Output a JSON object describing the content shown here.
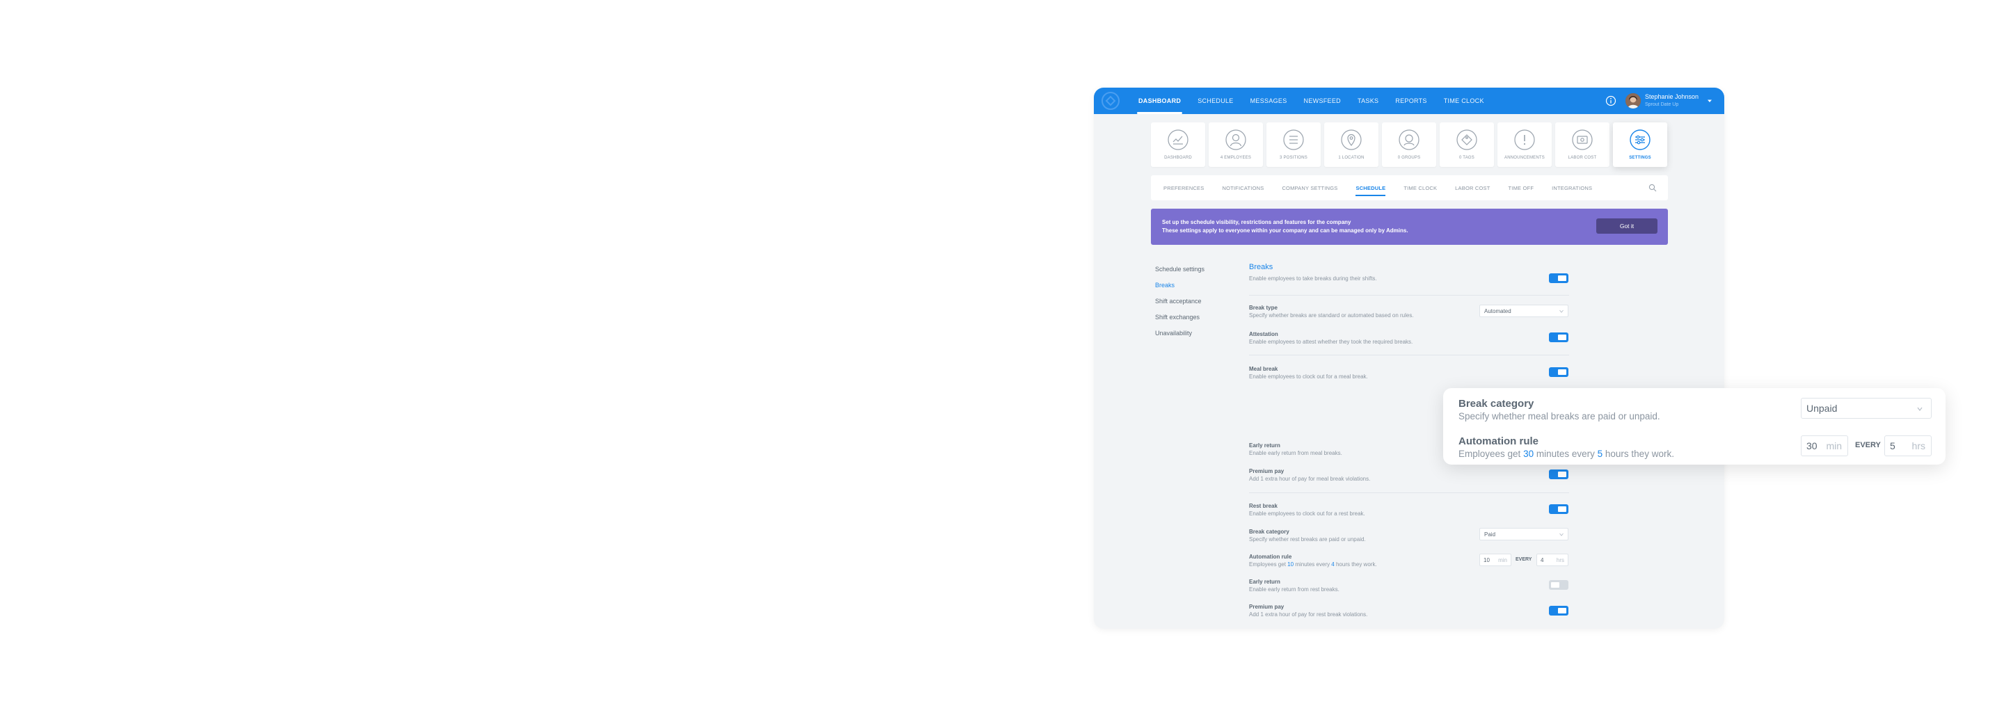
{
  "nav": {
    "items": [
      "DASHBOARD",
      "SCHEDULE",
      "MESSAGES",
      "NEWSFEED",
      "TASKS",
      "REPORTS",
      "TIME CLOCK"
    ],
    "user_name": "Stephanie Johnson",
    "user_company": "Sprout Date Up"
  },
  "tiles": [
    {
      "label": "DASHBOARD",
      "icon": "dashboard-icon"
    },
    {
      "label": "4 EMPLOYEES",
      "icon": "employees-icon"
    },
    {
      "label": "3 POSITIONS",
      "icon": "positions-icon"
    },
    {
      "label": "1 LOCATION",
      "icon": "location-icon"
    },
    {
      "label": "0 GROUPS",
      "icon": "groups-icon"
    },
    {
      "label": "0 TAGS",
      "icon": "tag-icon"
    },
    {
      "label": "ANNOUNCEMENTS",
      "icon": "alert-icon"
    },
    {
      "label": "LABOR COST",
      "icon": "labor-cost-icon"
    },
    {
      "label": "SETTINGS",
      "icon": "settings-icon"
    }
  ],
  "subtabs": [
    "PREFERENCES",
    "NOTIFICATIONS",
    "COMPANY SETTINGS",
    "SCHEDULE",
    "TIME CLOCK",
    "LABOR COST",
    "TIME OFF",
    "INTEGRATIONS"
  ],
  "banner": {
    "line1": "Set up the schedule visibility, restrictions and features for the company",
    "line2": "These settings apply to everyone within your company and can be managed only by Admins.",
    "button": "Got it"
  },
  "side_menu": [
    "Schedule settings",
    "Breaks",
    "Shift acceptance",
    "Shift exchanges",
    "Unavailability"
  ],
  "breaks": {
    "title": "Breaks",
    "desc": "Enable employees to take breaks during their shifts.",
    "break_type": {
      "title": "Break type",
      "desc": "Specify whether breaks are standard or automated based on rules.",
      "value": "Automated"
    },
    "attestation": {
      "title": "Attestation",
      "desc": "Enable employees to attest whether they took the required breaks."
    },
    "meal_break": {
      "title": "Meal break",
      "desc": "Enable employees to clock out for a meal break."
    },
    "meal_early_return": {
      "title": "Early return",
      "desc": "Enable early return from meal breaks."
    },
    "meal_premium_pay": {
      "title": "Premium pay",
      "desc": "Add 1 extra hour of pay for meal break violations."
    },
    "rest_break": {
      "title": "Rest break",
      "desc": "Enable employees to clock out for a rest break."
    },
    "rest_category": {
      "title": "Break category",
      "desc": "Specify whether rest breaks are paid or unpaid.",
      "value": "Paid"
    },
    "rest_automation": {
      "title": "Automation rule",
      "desc_pre": "Employees get ",
      "minutes": "10",
      "desc_mid": " minutes every ",
      "hours": "4",
      "desc_post": " hours they work.",
      "min_unit": "min",
      "every": "EVERY",
      "hrs_unit": "hrs"
    },
    "rest_early_return": {
      "title": "Early return",
      "desc": "Enable early return from rest breaks."
    },
    "rest_premium_pay": {
      "title": "Premium pay",
      "desc": "Add 1 extra hour of pay for rest break violations."
    }
  },
  "floating_card": {
    "category_title": "Break category",
    "category_desc": "Specify whether meal breaks are paid or unpaid.",
    "category_value": "Unpaid",
    "automation_title": "Automation rule",
    "desc_pre": "Employees get ",
    "minutes": "30",
    "desc_mid": " minutes every ",
    "hours": "5",
    "desc_post": " hours they work.",
    "min_unit": "min",
    "every": "EVERY",
    "hrs_unit": "hrs"
  },
  "colors": {
    "primary": "#1a85e8",
    "banner": "#7b6fd0",
    "banner_button": "#4e4687",
    "background": "#f2f4f6"
  }
}
